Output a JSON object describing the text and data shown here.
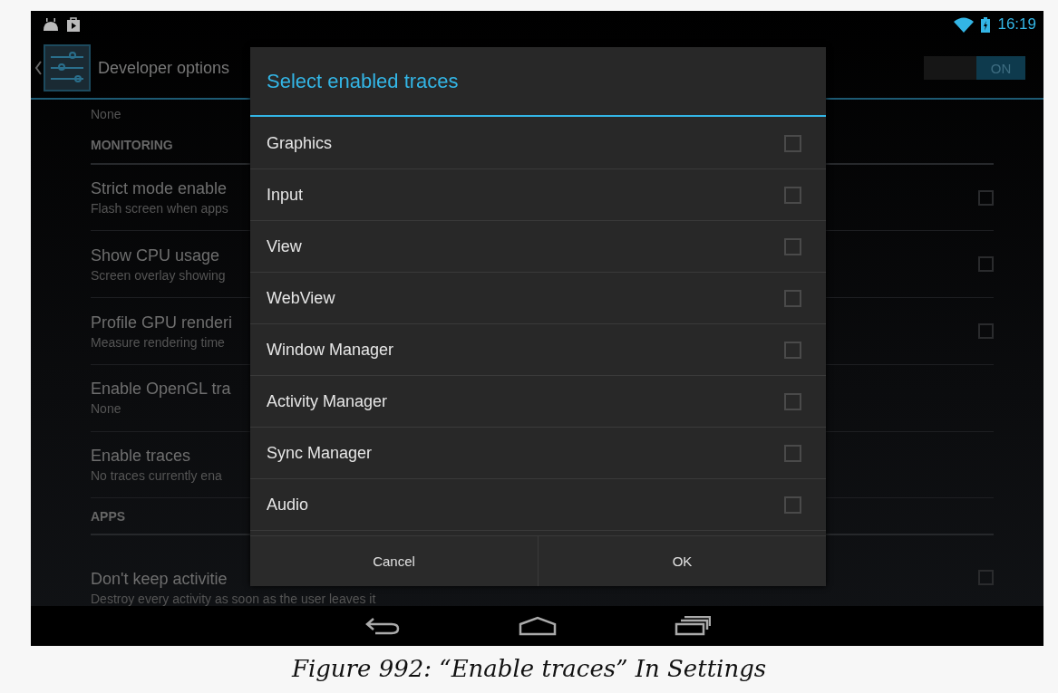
{
  "status_bar": {
    "time": "16:19"
  },
  "action_bar": {
    "title": "Developer options",
    "switch": {
      "label": "ON",
      "on": true
    }
  },
  "settings": [
    {
      "kind": "summary",
      "summary": "None"
    },
    {
      "kind": "header",
      "title": "MONITORING"
    },
    {
      "kind": "check",
      "title": "Strict mode enable",
      "summary": "Flash screen when apps",
      "checked": false
    },
    {
      "kind": "check",
      "title": "Show CPU usage",
      "summary": "Screen overlay showing",
      "checked": false
    },
    {
      "kind": "check",
      "title": "Profile GPU renderi",
      "summary": "Measure rendering time",
      "checked": false
    },
    {
      "kind": "value",
      "title": "Enable OpenGL tra",
      "summary": "None"
    },
    {
      "kind": "value",
      "title": "Enable traces",
      "summary": "No traces currently ena"
    },
    {
      "kind": "header",
      "title": "APPS"
    },
    {
      "kind": "check",
      "title": "Don't keep activitie",
      "summary": "Destroy every activity as soon as the user leaves it",
      "checked": false
    }
  ],
  "dialog": {
    "title": "Select enabled traces",
    "items": [
      {
        "label": "Graphics",
        "checked": false
      },
      {
        "label": "Input",
        "checked": false
      },
      {
        "label": "View",
        "checked": false
      },
      {
        "label": "WebView",
        "checked": false
      },
      {
        "label": "Window Manager",
        "checked": false
      },
      {
        "label": "Activity Manager",
        "checked": false
      },
      {
        "label": "Sync Manager",
        "checked": false
      },
      {
        "label": "Audio",
        "checked": false
      }
    ],
    "buttons": [
      "Cancel",
      "OK"
    ]
  },
  "caption": "Figure 992: “Enable traces” In Settings"
}
